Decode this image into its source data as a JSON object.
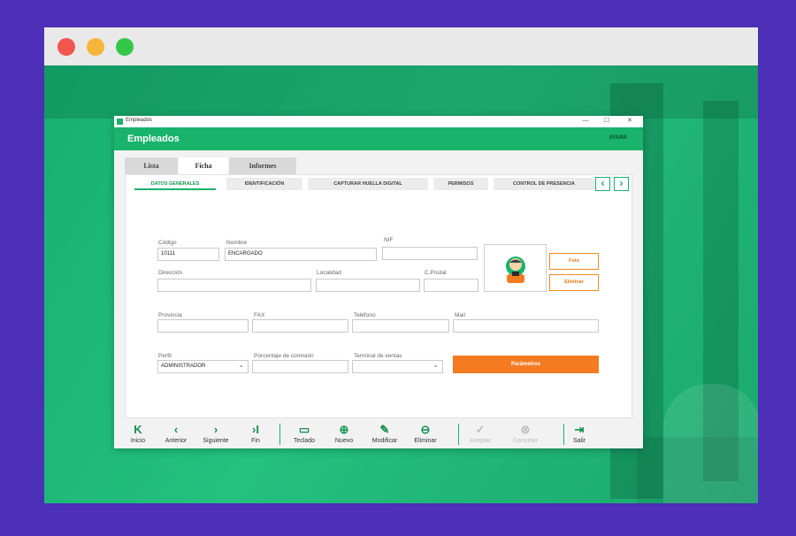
{
  "window": {
    "title": "Empleados",
    "header_title": "Empleados",
    "brand": "AYARA",
    "controls": {
      "minimize": "—",
      "maximize": "☐",
      "close": "✕"
    }
  },
  "tabs": [
    "Lista",
    "Ficha",
    "Informes"
  ],
  "active_tab": "Ficha",
  "subtabs": [
    "DATOS GENERALES",
    "IDENTIFICACIÓN",
    "CAPTURAR HUELLA DIGITAL",
    "PERMISOS",
    "CONTROL DE PRESENCIA"
  ],
  "active_subtab": "DATOS GENERALES",
  "nav_arrows": {
    "prev": "‹",
    "next": "›"
  },
  "form": {
    "codigo": {
      "label": "Código",
      "value": "10111"
    },
    "nombre": {
      "label": "Nombre",
      "value": "ENCARGADO"
    },
    "nif": {
      "label": "NIF",
      "value": ""
    },
    "direccion": {
      "label": "Dirección",
      "value": ""
    },
    "localidad": {
      "label": "Localidad",
      "value": ""
    },
    "cpostal": {
      "label": "C.Postal",
      "value": ""
    },
    "provincia": {
      "label": "Provincia",
      "value": ""
    },
    "fax": {
      "label": "FAX",
      "value": ""
    },
    "telefono": {
      "label": "Teléfono",
      "value": ""
    },
    "mail": {
      "label": "Mail",
      "value": ""
    },
    "perfil": {
      "label": "Perfil",
      "value": "ADMINISTRADOR"
    },
    "comision": {
      "label": "Porcentaje de comisión",
      "value": ""
    },
    "terminal": {
      "label": "Terminal de ventas",
      "value": ""
    }
  },
  "photo_buttons": {
    "foto": "Foto",
    "eliminar": "Eliminar"
  },
  "parametros_label": "Parámetros",
  "toolbar": [
    {
      "label": "Inicio",
      "icon": "first-icon",
      "glyph": "K",
      "enabled": true
    },
    {
      "label": "Anterior",
      "icon": "prev-icon",
      "glyph": "‹",
      "enabled": true
    },
    {
      "label": "Siguiente",
      "icon": "next-icon",
      "glyph": "›",
      "enabled": true
    },
    {
      "label": "Fin",
      "icon": "last-icon",
      "glyph": "›I",
      "enabled": true
    },
    {
      "label": "Teclado",
      "icon": "keyboard-icon",
      "glyph": "▭",
      "enabled": true
    },
    {
      "label": "Nuevo",
      "icon": "add-icon",
      "glyph": "⊕",
      "enabled": true
    },
    {
      "label": "Modificar",
      "icon": "pencil-icon",
      "glyph": "✎",
      "enabled": true
    },
    {
      "label": "Eliminar",
      "icon": "remove-icon",
      "glyph": "⊖",
      "enabled": true
    },
    {
      "label": "Aceptar",
      "icon": "check-icon",
      "glyph": "✓",
      "enabled": false
    },
    {
      "label": "Cancelar",
      "icon": "cancel-icon",
      "glyph": "⊗",
      "enabled": false
    },
    {
      "label": "Salir",
      "icon": "exit-icon",
      "glyph": "⇥",
      "enabled": true
    }
  ],
  "colors": {
    "accent": "#19b36b",
    "orange": "#f47b20",
    "frame": "#4d2fb8"
  }
}
